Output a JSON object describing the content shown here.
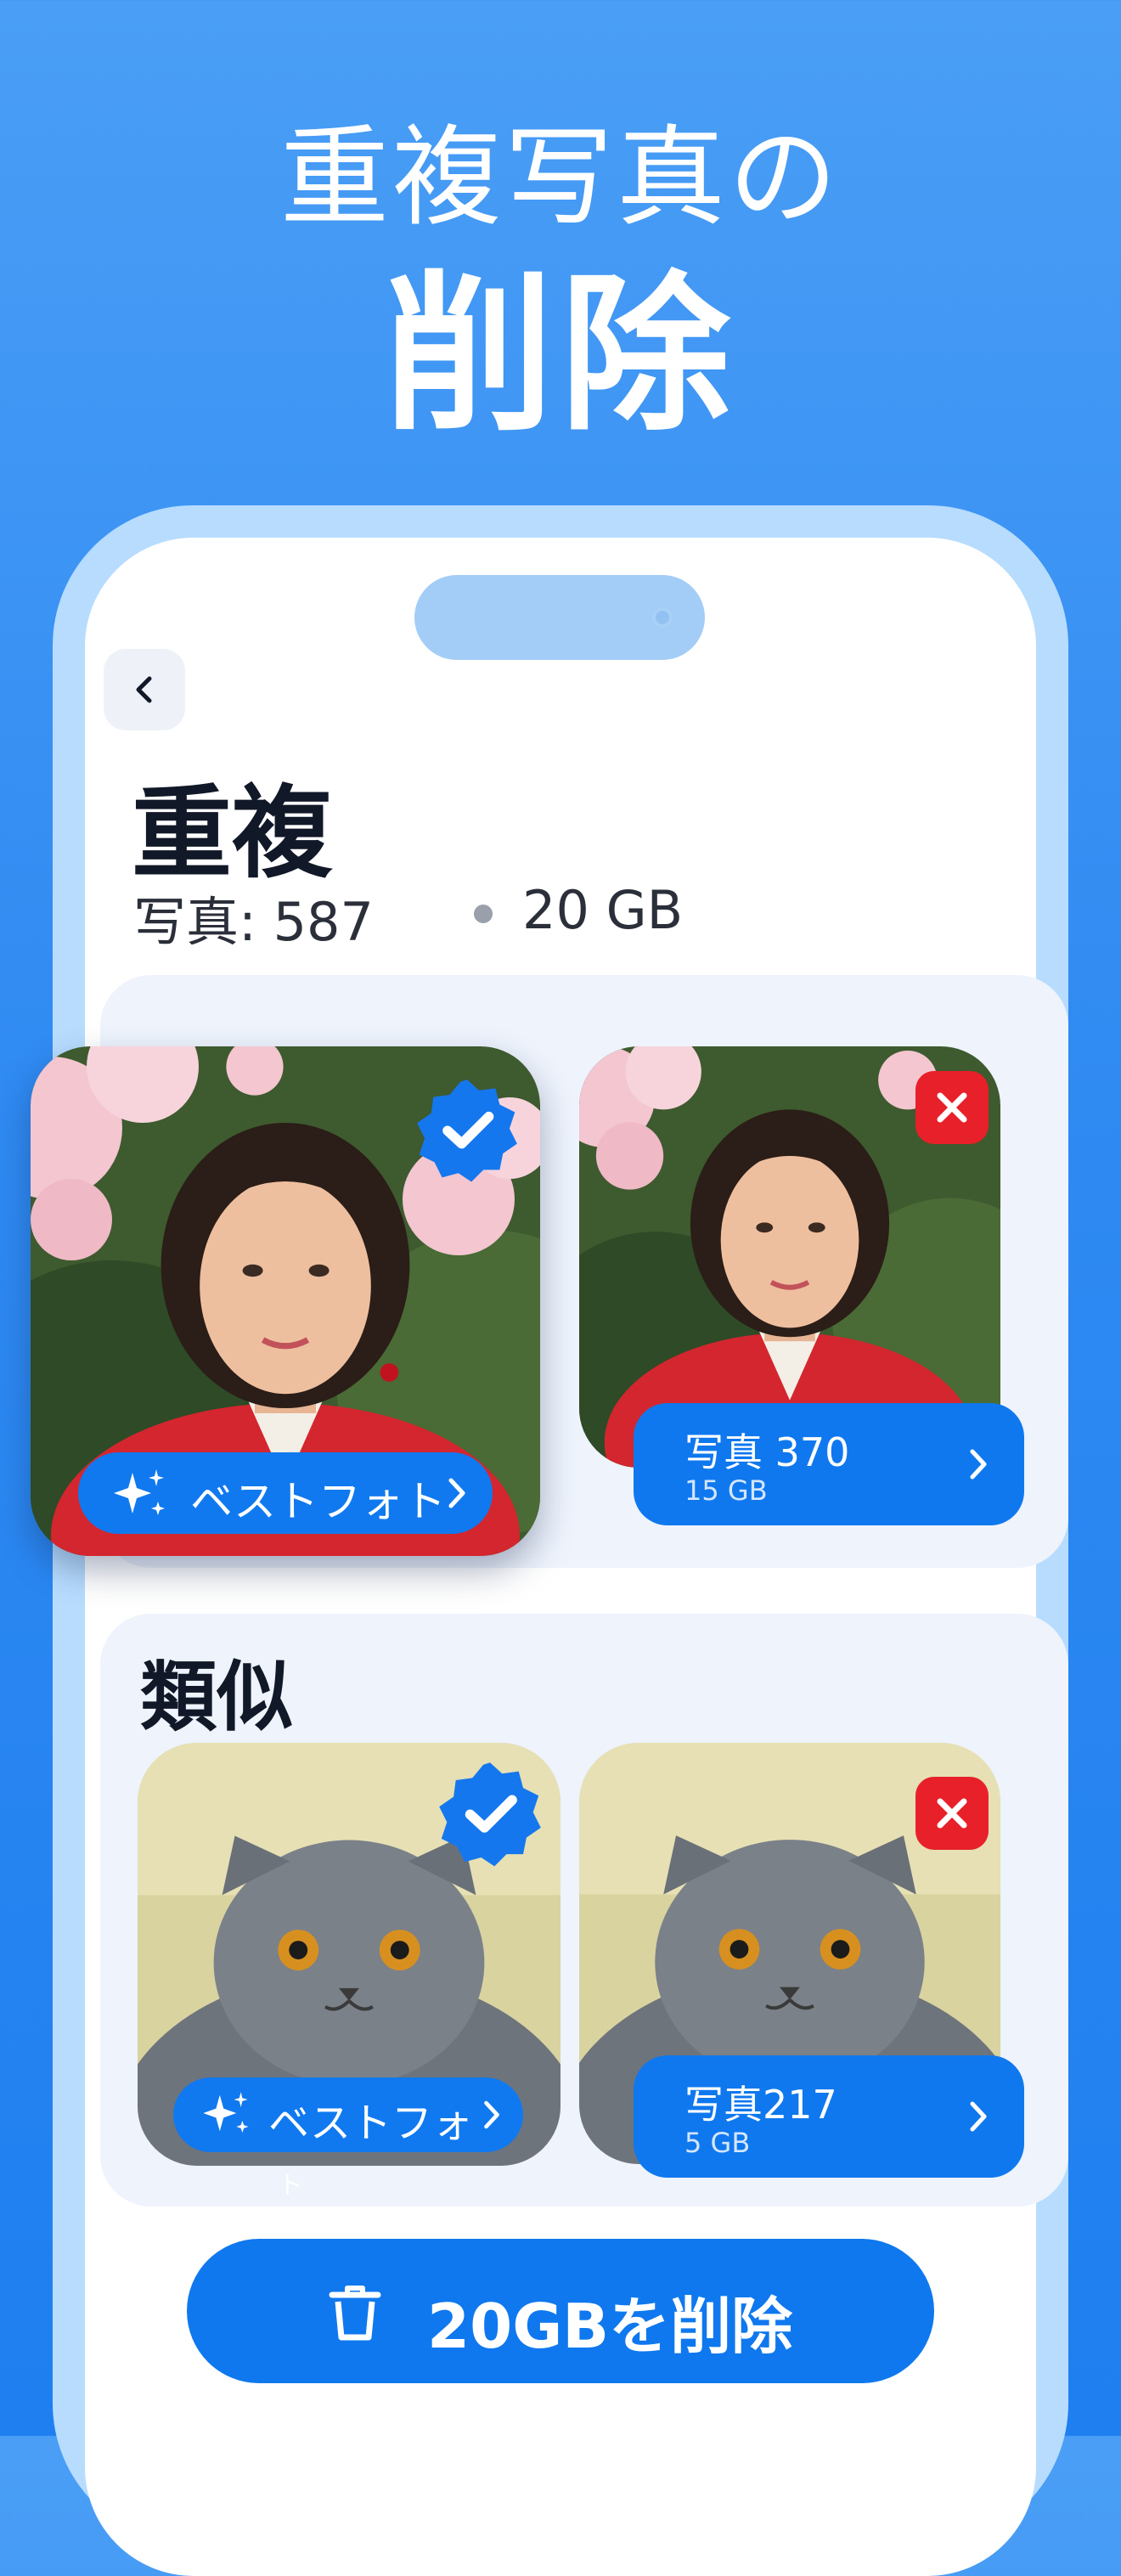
{
  "promo": {
    "headline_line1": "重複写真の",
    "headline_line2": "削除"
  },
  "screen": {
    "back_icon": "chevron-left-icon",
    "title": "重複",
    "photo_count": "写真: 587",
    "total_size": "20 GB"
  },
  "duplicates_group": {
    "best_badge_label": "ベストフォト",
    "other_count_label": "写真 370",
    "other_size_label": "15 GB",
    "best_photo_subject": "woman in red kimono under cherry blossoms",
    "other_photo_subject": "woman in red kimono under cherry blossoms"
  },
  "similar_group": {
    "title": "類似",
    "best_badge_label": "ベストフォ",
    "best_badge_overflow": "ト",
    "other_count_label": "写真217",
    "other_size_label": "5 GB",
    "best_photo_subject": "grey scottish fold cat",
    "other_photo_subject": "grey scottish fold cat"
  },
  "delete_action": {
    "label": "20GBを削除",
    "icon": "trash-icon"
  },
  "colors": {
    "background_top": "#4a9ef5",
    "background_bottom": "#1f7ff0",
    "accent": "#0f78ee",
    "reject": "#e8202a",
    "phone_frame": "#b7dcfe",
    "panel": "#eef3fc"
  }
}
